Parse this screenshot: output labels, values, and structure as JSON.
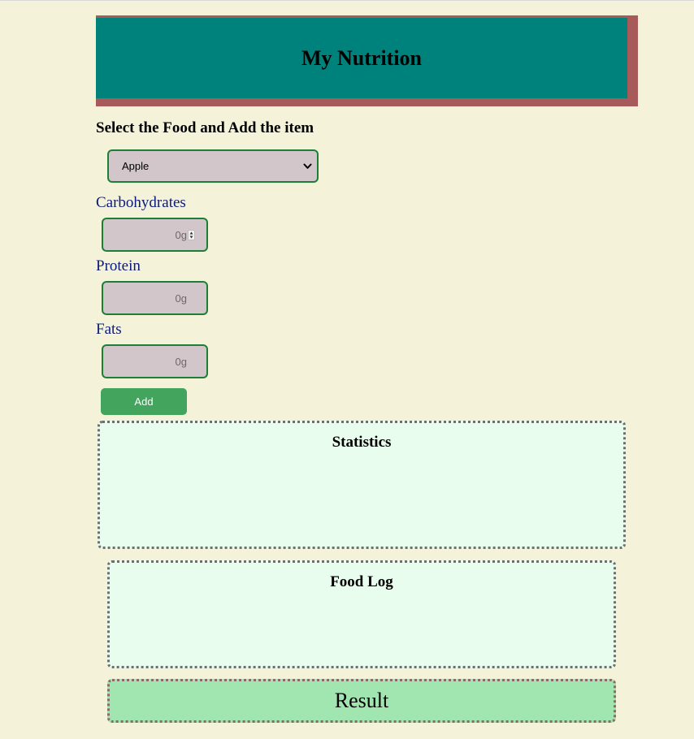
{
  "header": {
    "title": "My Nutrition"
  },
  "form": {
    "select_label": "Select the Food and Add the item",
    "food_select": {
      "value": "Apple"
    },
    "carbohydrates": {
      "label": "Carbohydrates",
      "value": "0g"
    },
    "protein": {
      "label": "Protein",
      "value": "0g"
    },
    "fats": {
      "label": "Fats",
      "value": "0g"
    },
    "add_label": "Add"
  },
  "panels": {
    "statistics_title": "Statistics",
    "food_log_title": "Food Log",
    "result_label": "Result"
  },
  "colors": {
    "page_background": "#f4f2d8",
    "header_background": "#00827c",
    "header_shadow": "#a8595a",
    "input_background": "#d2c6ca",
    "input_border": "#1d7f36",
    "label_text": "#0c1a7a",
    "add_button": "#43a45d",
    "panel_background": "#e9fdee",
    "result_background": "#a1e5b0"
  }
}
